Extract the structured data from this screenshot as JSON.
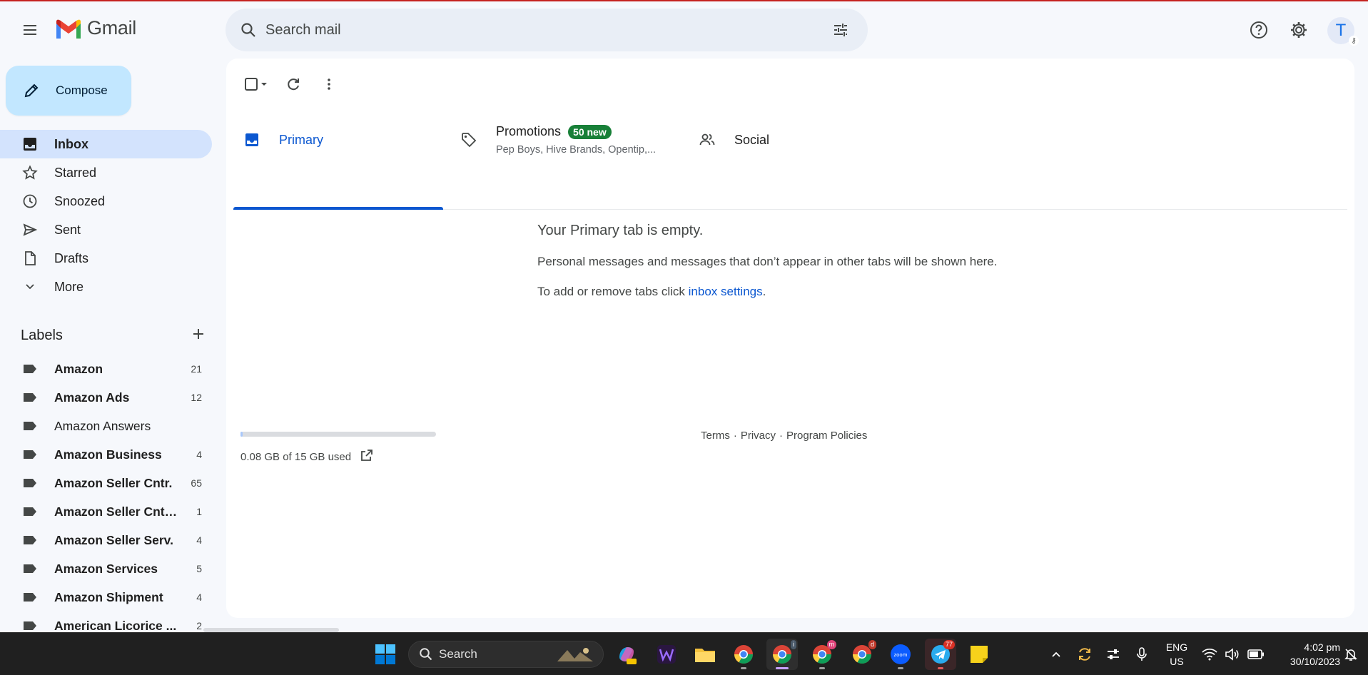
{
  "app": {
    "name": "Gmail"
  },
  "search": {
    "placeholder": "Search mail"
  },
  "avatar": {
    "letter": "T"
  },
  "compose": {
    "label": "Compose"
  },
  "nav": {
    "inbox": "Inbox",
    "starred": "Starred",
    "snoozed": "Snoozed",
    "sent": "Sent",
    "drafts": "Drafts",
    "more": "More"
  },
  "labels": {
    "title": "Labels",
    "items": [
      {
        "name": "Amazon",
        "count": "21",
        "bold": true
      },
      {
        "name": "Amazon Ads",
        "count": "12",
        "bold": true
      },
      {
        "name": "Amazon Answers",
        "count": "",
        "bold": false
      },
      {
        "name": "Amazon Business",
        "count": "4",
        "bold": true
      },
      {
        "name": "Amazon Seller Cntr.",
        "count": "65",
        "bold": true
      },
      {
        "name": "Amazon Seller Cntr...",
        "count": "1",
        "bold": true
      },
      {
        "name": "Amazon Seller Serv.",
        "count": "4",
        "bold": true
      },
      {
        "name": "Amazon Services",
        "count": "5",
        "bold": true
      },
      {
        "name": "Amazon Shipment",
        "count": "4",
        "bold": true
      },
      {
        "name": "American Licorice ...",
        "count": "2",
        "bold": true
      }
    ]
  },
  "tabs": {
    "primary": "Primary",
    "promotions": "Promotions",
    "promotions_badge": "50 new",
    "promotions_senders": "Pep Boys, Hive Brands, Opentip,...",
    "social": "Social"
  },
  "empty": {
    "heading": "Your Primary tab is empty.",
    "line1": "Personal messages and messages that don’t appear in other tabs will be shown here.",
    "line2_prefix": "To add or remove tabs click ",
    "line2_link": "inbox settings",
    "line2_suffix": "."
  },
  "storage": {
    "used_text": "0.08 GB of 15 GB used",
    "used_fraction": 0.005
  },
  "footer": {
    "terms": "Terms",
    "privacy": "Privacy",
    "policies": "Program Policies",
    "sep": "·"
  },
  "taskbar": {
    "search_label": "Search",
    "lang_line1": "ENG",
    "lang_line2": "US",
    "time": "4:02 pm",
    "date": "30/10/2023",
    "chrome_badge_1": "i",
    "chrome_badge_2": "m",
    "chrome_badge_3": "d",
    "telegram_badge": "77"
  },
  "colors": {
    "accent": "#0b57d0",
    "compose_bg": "#c2e7ff",
    "active_nav": "#d3e3fd",
    "badge_green": "#188038"
  }
}
